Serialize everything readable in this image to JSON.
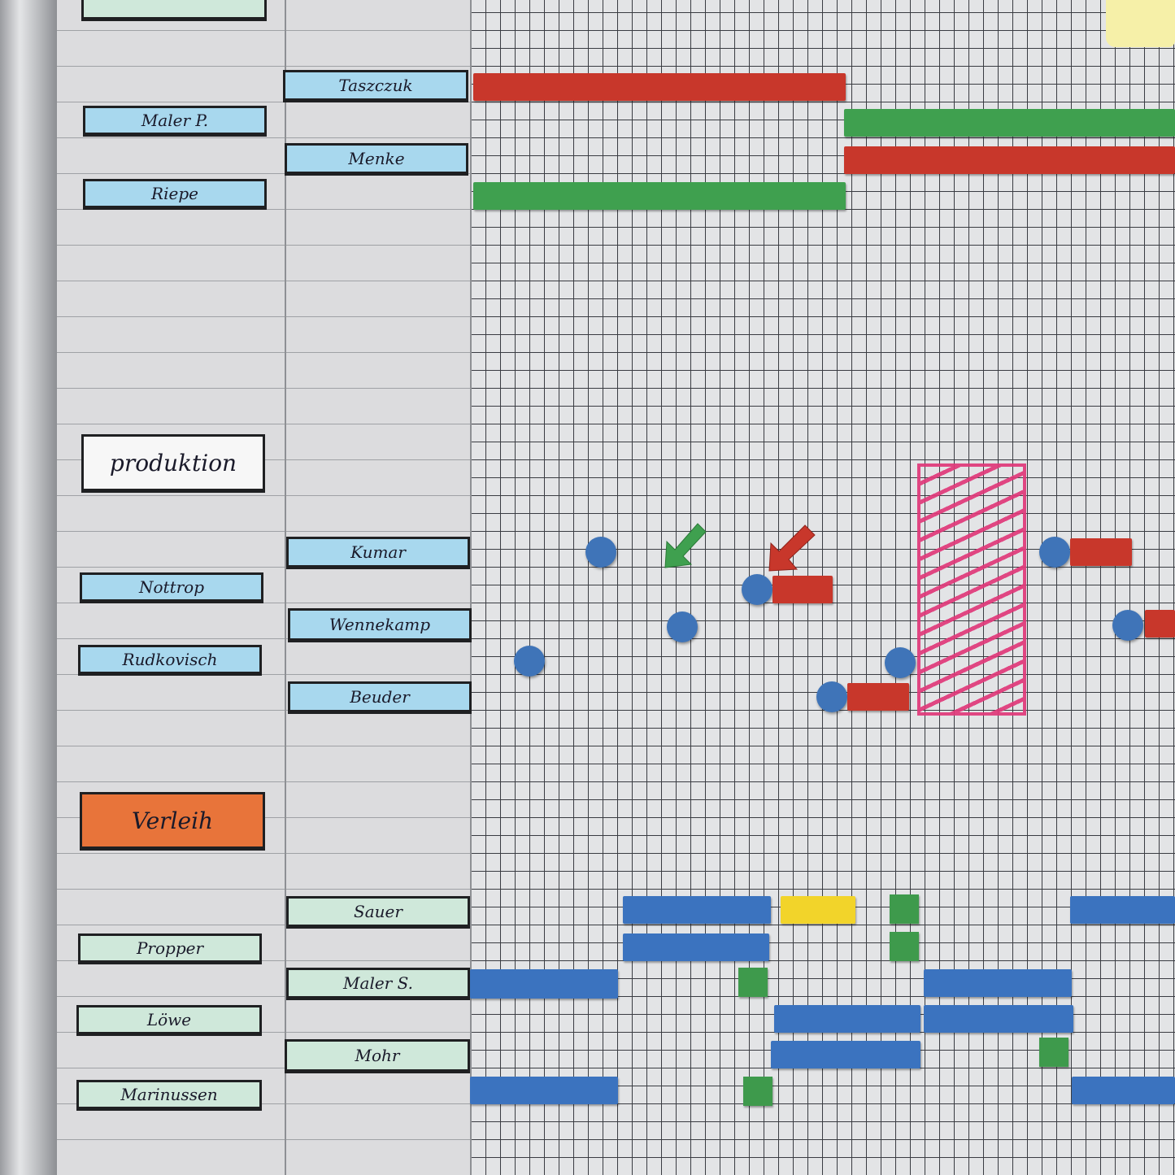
{
  "board": {
    "groups": [
      {
        "label": "produktion"
      },
      {
        "label": "Verleih"
      }
    ],
    "staff_col1": [
      {
        "name": "Maler P."
      },
      {
        "name": "Riepe"
      },
      {
        "name": "Nottrop"
      },
      {
        "name": "Rudkovisch"
      },
      {
        "name": "Propper"
      },
      {
        "name": "Löwe"
      },
      {
        "name": "Marinussen"
      }
    ],
    "staff_col2": [
      {
        "name": "Taszczuk"
      },
      {
        "name": "Menke"
      },
      {
        "name": "Kumar"
      },
      {
        "name": "Wennekamp"
      },
      {
        "name": "Beuder"
      },
      {
        "name": "Sauer"
      },
      {
        "name": "Maler S."
      },
      {
        "name": "Mohr"
      }
    ]
  },
  "colors": {
    "red": "#c8372b",
    "green": "#3fa04f",
    "blue": "#3b73bf",
    "yellow": "#f2d42a",
    "magenta": "#e0397a",
    "label_blue": "#a8d8ee",
    "label_green": "#cfe8da",
    "label_orange": "#e8743a"
  },
  "icons": {
    "magnet_dot": "blue-round-magnet",
    "arrow_green": "green-arrow-magnet",
    "arrow_red": "red-arrow-magnet",
    "hatched_block": "pink-hatched-marker-area",
    "sticky_note": "yellow-sticky-note"
  }
}
